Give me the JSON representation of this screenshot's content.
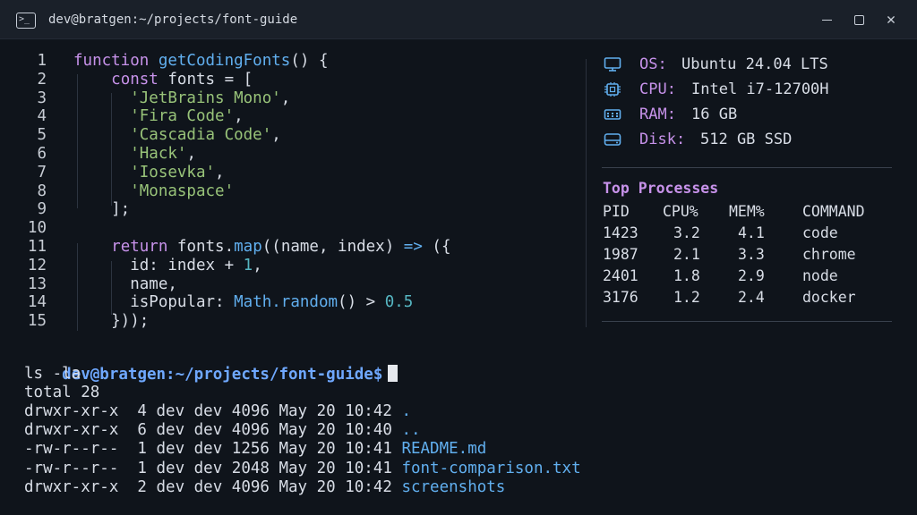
{
  "window": {
    "title": "dev@bratgen:~/projects/font-guide",
    "icon": "terminal-icon",
    "controls": [
      "minimize-icon",
      "maximize-icon",
      "close-icon"
    ]
  },
  "editor": {
    "lines": [
      {
        "n": "1",
        "parts": [
          [
            "kw",
            "function "
          ],
          [
            "fn",
            "getCodingFonts"
          ],
          [
            "plain",
            "() {"
          ]
        ]
      },
      {
        "n": "2",
        "parts": [
          [
            "plain",
            "    "
          ],
          [
            "kw",
            "const"
          ],
          [
            "plain",
            " fonts = ["
          ]
        ]
      },
      {
        "n": "3",
        "parts": [
          [
            "plain",
            "      "
          ],
          [
            "str",
            "'JetBrains Mono'"
          ],
          [
            "plain",
            ","
          ]
        ]
      },
      {
        "n": "4",
        "parts": [
          [
            "plain",
            "      "
          ],
          [
            "str",
            "'Fira Code'"
          ],
          [
            "plain",
            ","
          ]
        ]
      },
      {
        "n": "5",
        "parts": [
          [
            "plain",
            "      "
          ],
          [
            "str",
            "'Cascadia Code'"
          ],
          [
            "plain",
            ","
          ]
        ]
      },
      {
        "n": "6",
        "parts": [
          [
            "plain",
            "      "
          ],
          [
            "str",
            "'Hack'"
          ],
          [
            "plain",
            ","
          ]
        ]
      },
      {
        "n": "7",
        "parts": [
          [
            "plain",
            "      "
          ],
          [
            "str",
            "'Iosevka'"
          ],
          [
            "plain",
            ","
          ]
        ]
      },
      {
        "n": "8",
        "parts": [
          [
            "plain",
            "      "
          ],
          [
            "str",
            "'Monaspace'"
          ]
        ]
      },
      {
        "n": "9",
        "parts": [
          [
            "plain",
            "    ];"
          ]
        ]
      },
      {
        "n": "10",
        "parts": []
      },
      {
        "n": "11",
        "parts": [
          [
            "plain",
            "    "
          ],
          [
            "kw",
            "return"
          ],
          [
            "plain",
            " fonts."
          ],
          [
            "fn",
            "map"
          ],
          [
            "plain",
            "((name, index) "
          ],
          [
            "fn",
            "=>"
          ],
          [
            "plain",
            " ({"
          ]
        ]
      },
      {
        "n": "12",
        "parts": [
          [
            "plain",
            "      id: index + "
          ],
          [
            "num",
            "1"
          ],
          [
            "plain",
            ","
          ]
        ]
      },
      {
        "n": "13",
        "parts": [
          [
            "plain",
            "      name,"
          ]
        ]
      },
      {
        "n": "14",
        "parts": [
          [
            "plain",
            "      isPopular: "
          ],
          [
            "fn",
            "Math.random"
          ],
          [
            "plain",
            "() > "
          ],
          [
            "num",
            "0.5"
          ]
        ]
      },
      {
        "n": "15",
        "parts": [
          [
            "plain",
            "    }));"
          ]
        ]
      }
    ]
  },
  "sysinfo": {
    "os": {
      "label": "OS:",
      "value": "Ubuntu 24.04 LTS",
      "icon": "monitor-icon"
    },
    "cpu": {
      "label": "CPU:",
      "value": "Intel i7-12700H",
      "icon": "cpu-icon"
    },
    "ram": {
      "label": "RAM:",
      "value": "16 GB",
      "icon": "memory-icon"
    },
    "disk": {
      "label": "Disk:",
      "value": "512 GB SSD",
      "icon": "disk-icon"
    }
  },
  "processes": {
    "title": "Top Processes",
    "headers": [
      "PID",
      "CPU%",
      "MEM%",
      "COMMAND"
    ],
    "rows": [
      [
        "1423",
        "3.2",
        "4.1",
        "code"
      ],
      [
        "1987",
        "2.1",
        "3.3",
        "chrome"
      ],
      [
        "2401",
        "1.8",
        "2.9",
        "node"
      ],
      [
        "3176",
        "1.2",
        "2.4",
        "docker"
      ]
    ]
  },
  "shell": {
    "prompt": "dev@bratgen:~/projects/font-guide$",
    "command": "ls -la",
    "total": "total 28",
    "entries": [
      {
        "meta": "drwxr-xr-x  4 dev dev 4096 May 20 10:42 ",
        "name": "."
      },
      {
        "meta": "drwxr-xr-x  6 dev dev 4096 May 20 10:40 ",
        "name": ".."
      },
      {
        "meta": "-rw-r--r--  1 dev dev 1256 May 20 10:41 ",
        "name": "README.md"
      },
      {
        "meta": "-rw-r--r--  1 dev dev 2048 May 20 10:41 ",
        "name": "font-comparison.txt"
      },
      {
        "meta": "drwxr-xr-x  2 dev dev 4096 May 20 10:42 ",
        "name": "screenshots"
      }
    ]
  },
  "colors": {
    "keyword": "#c792ea",
    "function": "#61afef",
    "string": "#98c379",
    "number": "#56b6c2",
    "prompt": "#6fa8ff"
  }
}
